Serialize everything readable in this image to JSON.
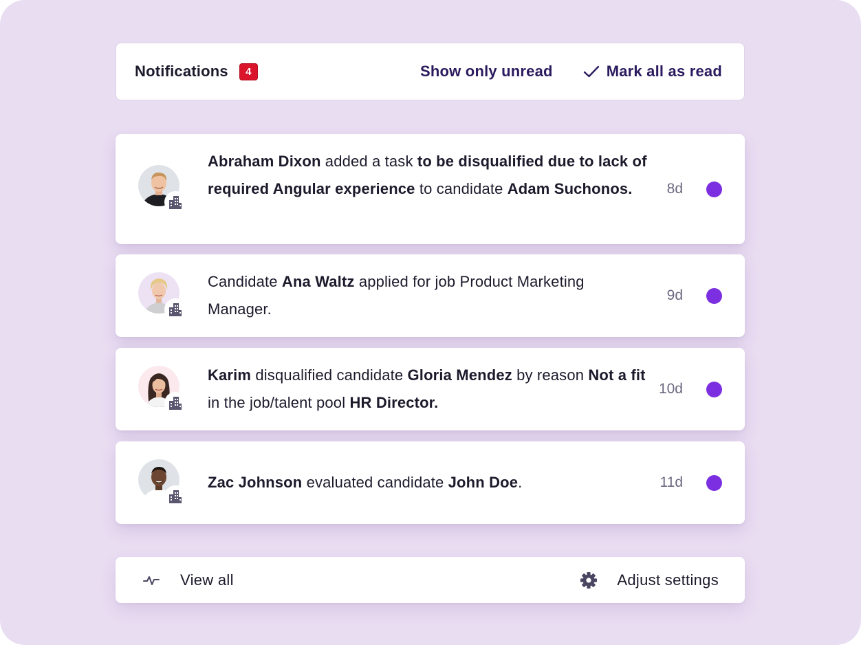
{
  "header": {
    "title": "Notifications",
    "unread_count": "4",
    "show_unread_label": "Show only unread",
    "mark_all_label": "Mark all as read"
  },
  "notifications": [
    {
      "actor": "Abraham Dixon",
      "t1": " added a task ",
      "b2": "to be disqualified due to lack of required Angular experience",
      "t2": " to candidate ",
      "b3": "Adam Suchonos.",
      "time": "8d",
      "unread": true
    },
    {
      "t0": "Candidate ",
      "b1": "Ana Waltz",
      "t1": " applied for job Product Marketing Manager.",
      "time": "9d",
      "unread": true
    },
    {
      "b0": "Karim",
      "t1": " disqualified candidate ",
      "b1": "Gloria Mendez",
      "t2": " by reason ",
      "b2": "Not a fit",
      "t3": " in the job/talent pool ",
      "b3": "HR Director.",
      "time": "10d",
      "unread": true
    },
    {
      "b0": "Zac Johnson",
      "t1": " evaluated candidate ",
      "b1": "John Doe",
      "t2": ".",
      "time": "11d",
      "unread": true
    }
  ],
  "footer": {
    "view_all_label": "View all",
    "settings_label": "Adjust settings"
  },
  "icons": {
    "check": "check-icon",
    "activity": "activity-icon",
    "gear": "gear-icon",
    "organization": "building-icon"
  },
  "colors": {
    "background": "#e9ddf2",
    "badge": "#d9142b",
    "unread_dot": "#7b2fe0",
    "link": "#2b1b5e"
  }
}
